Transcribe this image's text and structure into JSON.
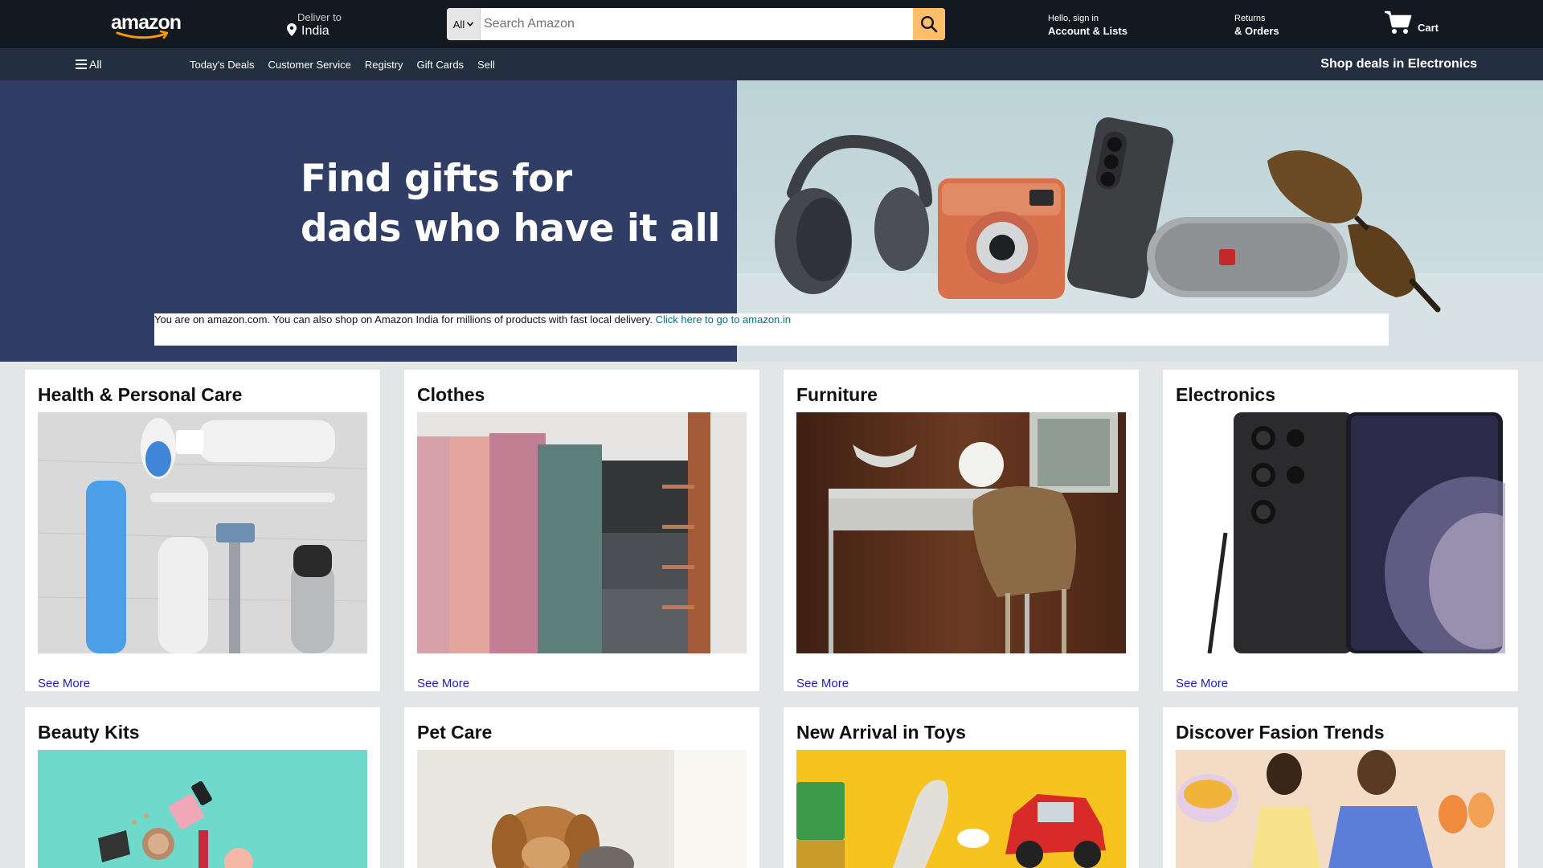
{
  "header": {
    "logo_text": "amazon",
    "deliver_small": "Deliver to",
    "deliver_big": "India",
    "search_category": "All",
    "search_placeholder": "Search Amazon",
    "account_small": "Hello, sign in",
    "account_big": "Account & Lists",
    "returns_small": "Returns",
    "returns_big": "& Orders",
    "cart_label": "Cart"
  },
  "subnav": {
    "all_label": "All",
    "links": [
      "Today's Deals",
      "Customer Service",
      "Registry",
      "Gift Cards",
      "Sell"
    ],
    "promo": "Shop deals in Electronics"
  },
  "hero": {
    "title_line1": "Find gifts for",
    "title_line2": "dads who have it all",
    "notice_text": "You are on amazon.com. You can also shop on Amazon India for millions of products with fast local delivery. ",
    "notice_link": "Click here to go to amazon.in"
  },
  "cards": [
    {
      "title": "Health & Personal Care",
      "link": "See More"
    },
    {
      "title": "Clothes",
      "link": "See More"
    },
    {
      "title": "Furniture",
      "link": "See More"
    },
    {
      "title": "Electronics",
      "link": "See More"
    },
    {
      "title": "Beauty Kits",
      "link": ""
    },
    {
      "title": "Pet Care",
      "link": ""
    },
    {
      "title": "New Arrival in Toys",
      "link": ""
    },
    {
      "title": "Discover Fasion Trends",
      "link": ""
    }
  ],
  "colors": {
    "nav_top": "#131921",
    "nav_sub": "#232f3e",
    "search_button": "#febd69",
    "hero_left": "#303e66",
    "link": "#007185"
  }
}
